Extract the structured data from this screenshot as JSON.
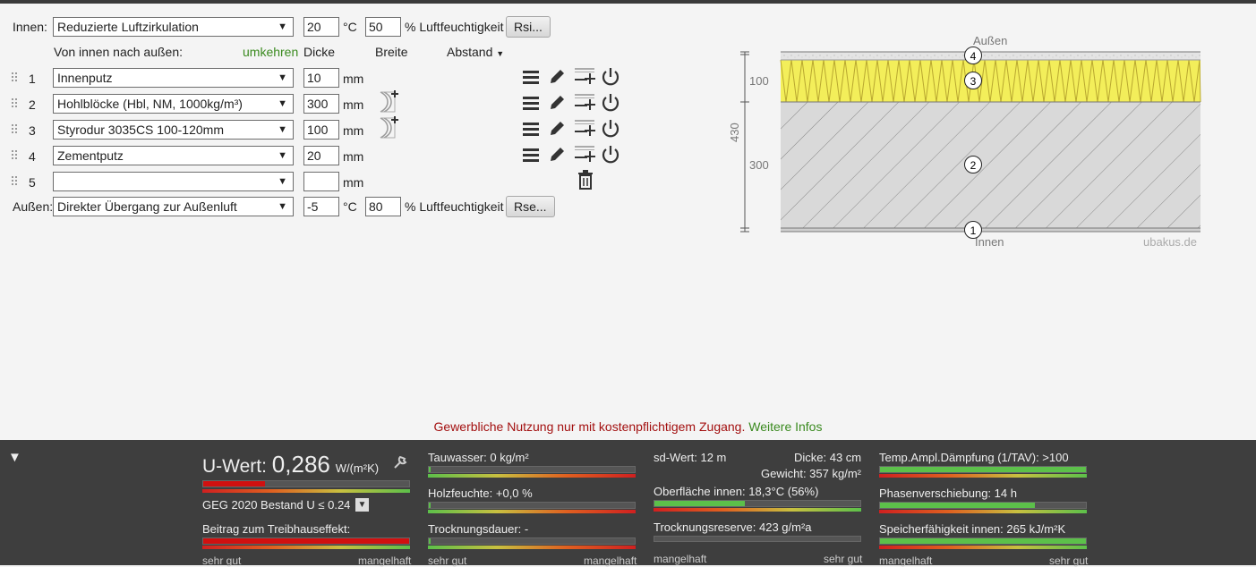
{
  "inside": {
    "label": "Innen:",
    "climate": "Reduzierte Luftzirkulation",
    "temp": "20",
    "temp_unit": "°C",
    "humidity": "50",
    "humidity_unit": "% Luftfeuchtigkeit",
    "rs_button": "Rsi..."
  },
  "outside": {
    "label": "Außen:",
    "climate": "Direkter Übergang zur Außenluft",
    "temp": "-5",
    "temp_unit": "°C",
    "humidity": "80",
    "humidity_unit": "% Luftfeuchtigkeit",
    "rs_button": "Rse..."
  },
  "header": {
    "direction": "Von innen nach außen:",
    "reverse": "umkehren",
    "thickness": "Dicke",
    "width": "Breite",
    "spacing": "Abstand"
  },
  "layers": [
    {
      "num": "1",
      "material": "Innenputz",
      "thickness": "10",
      "unit": "mm"
    },
    {
      "num": "2",
      "material": "Hohlblöcke (Hbl, NM, 1000kg/m³)",
      "thickness": "300",
      "unit": "mm"
    },
    {
      "num": "3",
      "material": "Styrodur 3035CS 100-120mm",
      "thickness": "100",
      "unit": "mm"
    },
    {
      "num": "4",
      "material": "Zementputz",
      "thickness": "20",
      "unit": "mm"
    },
    {
      "num": "5",
      "material": "",
      "thickness": "",
      "unit": "mm"
    }
  ],
  "diagram": {
    "outside_label": "Außen",
    "inside_label": "Innen",
    "watermark": "ubakus.de",
    "total": "430",
    "dim_insulation": "100",
    "dim_block": "300",
    "markers": [
      "4",
      "3",
      "2",
      "1"
    ]
  },
  "notice": {
    "text": "Gewerbliche Nutzung nur mit kostenpflichtigem Zugang.",
    "link": "Weitere Infos"
  },
  "results": {
    "u_label": "U-Wert:",
    "u_value": "0,286",
    "u_unit": "W/(m²K)",
    "geg": "GEG 2020 Bestand U ≤ 0.24",
    "greenhouse": "Beitrag zum Treibhauseffekt:",
    "condensate": "Tauwasser: 0 kg/m²",
    "wood_moisture": "Holzfeuchte: +0,0 %",
    "drying_time": "Trocknungsdauer: -",
    "sd": "sd-Wert: 12 m",
    "thickness": "Dicke: 43 cm",
    "weight": "Gewicht: 357 kg/m²",
    "surface": "Oberfläche innen: 18,3°C (56%)",
    "drying_reserve": "Trocknungsreserve: 423 g/m²a",
    "damping": "Temp.Ampl.Dämpfung (1/TAV): >100",
    "phase": "Phasenverschiebung: 14 h",
    "storage": "Speicherfähigkeit innen: 265 kJ/m²K",
    "scale_good": "sehr gut",
    "scale_bad": "mangelhaft",
    "u_fill": 0.3,
    "surface_fill": 0.44,
    "damping_fill": 1.0,
    "phase_fill": 0.75,
    "storage_fill": 1.0
  }
}
